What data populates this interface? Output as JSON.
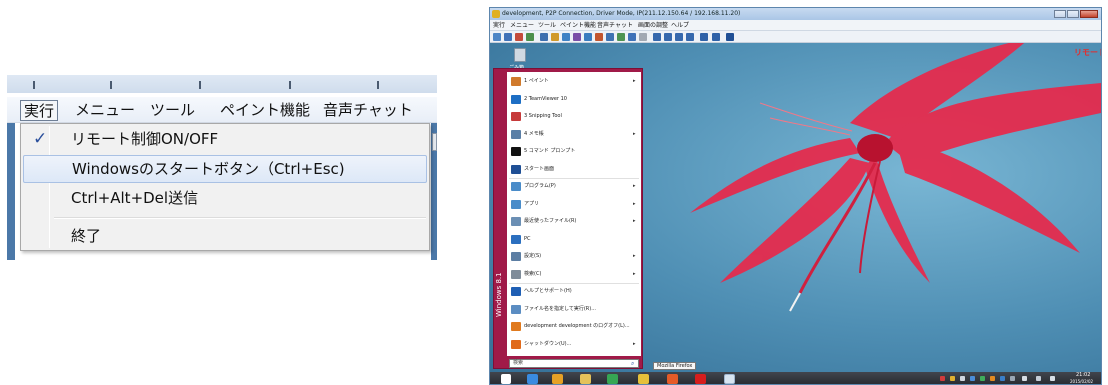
{
  "zoom": {
    "menubar": {
      "items": [
        "実行",
        "メニュー",
        "ツール",
        "ペイント機能",
        "音声チャット"
      ]
    },
    "dropdown": {
      "items": [
        {
          "label": "リモート制御ON/OFF",
          "checked": true
        },
        {
          "label": "Windowsのスタートボタン（Ctrl+Esc)",
          "highlighted": true
        },
        {
          "label": "Ctrl+Alt+Del送信"
        },
        {
          "label": "終了"
        }
      ],
      "check_glyph": "✓"
    }
  },
  "window": {
    "title": "development, P2P Connection, Driver Mode, IP(211.12.150.64 / 192.168.11.20)",
    "menubar": [
      "実行",
      "メニュー",
      "ツール",
      "ペイント機能",
      "音声チャット",
      "画面の調整",
      "ヘルプ"
    ],
    "desktop": {
      "recycle_bin_label": "ごみ箱",
      "remote_tag": "リモート"
    },
    "start_menu": {
      "brand": "Windows 8.1",
      "items": [
        {
          "label": "1 ペイント",
          "arrow": true,
          "icon_color": "#d07a2c"
        },
        {
          "label": "2 TeamViewer 10",
          "icon_color": "#1d6ec4"
        },
        {
          "label": "3 Snipping Tool",
          "icon_color": "#c63a3a"
        },
        {
          "label": "4 メモ帳",
          "arrow": true,
          "icon_color": "#5b7fa6"
        },
        {
          "label": "5 コマンド プロンプト",
          "icon_color": "#111111"
        },
        {
          "label": "スタート画面",
          "icon_color": "#1f4f95"
        },
        {
          "label": "プログラム(P)",
          "arrow": true,
          "icon_color": "#4a8cc9"
        },
        {
          "label": "アプリ",
          "arrow": true,
          "icon_color": "#4a8cc9"
        },
        {
          "label": "最近使ったファイル(R)",
          "arrow": true,
          "icon_color": "#6b8fb4"
        },
        {
          "label": "PC",
          "icon_color": "#2b6fbf"
        },
        {
          "label": "設定(S)",
          "arrow": true,
          "icon_color": "#5c7ea3"
        },
        {
          "label": "検索(C)",
          "arrow": true,
          "icon_color": "#7f8c99"
        },
        {
          "label": "ヘルプとサポート(H)",
          "icon_color": "#1f5fb4"
        },
        {
          "label": "ファイル名を指定して実行(R)...",
          "icon_color": "#5b8dc2"
        },
        {
          "label": "development development のログオフ(L)...",
          "icon_color": "#e07a1e"
        },
        {
          "label": "シャットダウン(U)...",
          "arrow": true,
          "icon_color": "#e06a1a"
        }
      ],
      "search_placeholder": "検索",
      "search_icon": "magnifier-icon"
    },
    "tooltip": "Mozilla Firefox",
    "taskbar": {
      "time": "21:02",
      "date": "2015/02/02"
    }
  }
}
